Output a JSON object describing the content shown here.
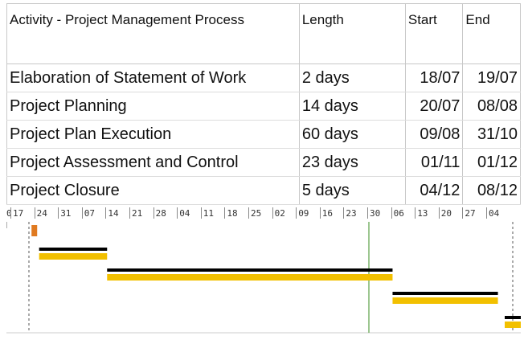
{
  "table": {
    "headers": {
      "activity": "Activity - Project Management Process",
      "length": "Length",
      "start": "Start",
      "end": "End"
    },
    "rows": [
      {
        "name": "Elaboration of Statement of Work",
        "length": "2 days",
        "start": "18/07",
        "end": "19/07"
      },
      {
        "name": "Project Planning",
        "length": "14 days",
        "start": "20/07",
        "end": "08/08"
      },
      {
        "name": "Project Plan Execution",
        "length": "60 days",
        "start": "09/08",
        "end": "31/10"
      },
      {
        "name": "Project Assessment and Control",
        "length": "23 days",
        "start": "01/11",
        "end": "01/12"
      },
      {
        "name": "Project Closure",
        "length": "5 days",
        "start": "04/12",
        "end": "08/12"
      }
    ]
  },
  "timescale": [
    "0",
    "17",
    "24",
    "31",
    "07",
    "14",
    "21",
    "28",
    "04",
    "11",
    "18",
    "25",
    "02",
    "09",
    "16",
    "23",
    "30",
    "06",
    "13",
    "20",
    "27",
    "04"
  ],
  "colors": {
    "baseline": "#000000",
    "progress": "#f2c000",
    "milestone": "#e07a20",
    "today_line": "#7bb36b",
    "grid": "#cccccc"
  }
}
